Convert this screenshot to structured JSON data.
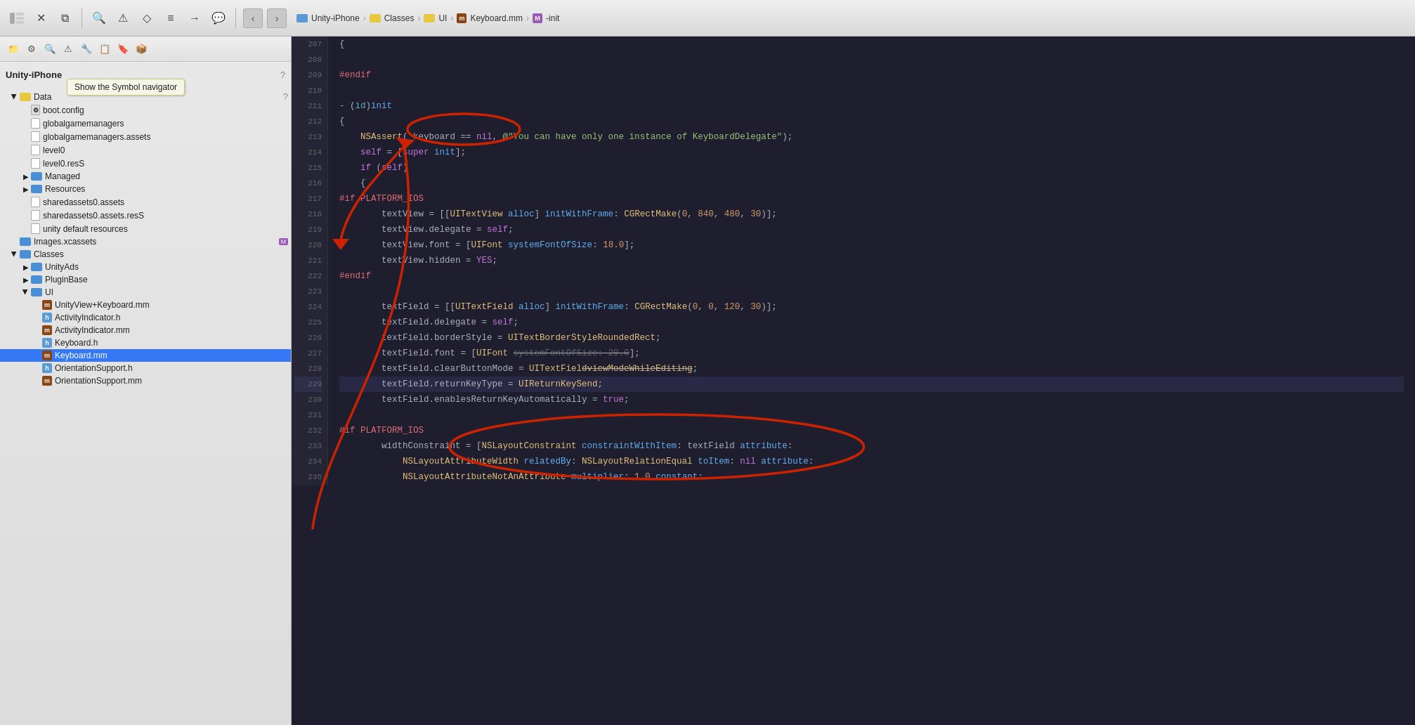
{
  "toolbar": {
    "icons": [
      "⊞",
      "✕",
      "⧉",
      "🔍",
      "⚠",
      "◇",
      "≡",
      "→",
      "💬"
    ],
    "grid_icon": "grid",
    "back_label": "‹",
    "forward_label": "›"
  },
  "breadcrumb": {
    "project": "Unity-iPhone",
    "folder1": "Classes",
    "folder2": "UI",
    "file": "Keyboard.mm",
    "symbol": "-init"
  },
  "sidebar": {
    "title": "Unity-iPhone",
    "items": [
      {
        "id": "unity-iphone",
        "label": "Unity-iPhone",
        "indent": 0,
        "type": "project",
        "expanded": true
      },
      {
        "id": "data",
        "label": "Data",
        "indent": 1,
        "type": "folder",
        "expanded": true
      },
      {
        "id": "boot-config",
        "label": "boot.config",
        "indent": 2,
        "type": "file"
      },
      {
        "id": "globalgamemanagers",
        "label": "globalgamemanagers",
        "indent": 2,
        "type": "file"
      },
      {
        "id": "globalgamemanagers-assets",
        "label": "globalgamemanagers.assets",
        "indent": 2,
        "type": "file"
      },
      {
        "id": "level0",
        "label": "level0",
        "indent": 2,
        "type": "file"
      },
      {
        "id": "level0-ress",
        "label": "level0.resS",
        "indent": 2,
        "type": "file"
      },
      {
        "id": "managed",
        "label": "Managed",
        "indent": 2,
        "type": "folder",
        "collapsed": true
      },
      {
        "id": "resources",
        "label": "Resources",
        "indent": 2,
        "type": "folder",
        "collapsed": true
      },
      {
        "id": "sharedassets0",
        "label": "sharedassets0.assets",
        "indent": 2,
        "type": "file"
      },
      {
        "id": "sharedassets0-ress",
        "label": "sharedassets0.assets.resS",
        "indent": 2,
        "type": "file"
      },
      {
        "id": "unity-default",
        "label": "unity default resources",
        "indent": 2,
        "type": "file"
      },
      {
        "id": "images-xcassets",
        "label": "Images.xcassets",
        "indent": 1,
        "type": "folder",
        "badge": "M"
      },
      {
        "id": "classes",
        "label": "Classes",
        "indent": 1,
        "type": "folder",
        "expanded": true
      },
      {
        "id": "unity-ads",
        "label": "UnityAds",
        "indent": 2,
        "type": "folder",
        "collapsed": true
      },
      {
        "id": "pluginbase",
        "label": "PluginBase",
        "indent": 2,
        "type": "folder",
        "collapsed": true
      },
      {
        "id": "ui",
        "label": "UI",
        "indent": 2,
        "type": "folder",
        "expanded": true
      },
      {
        "id": "unitview-keyboard",
        "label": "UnityView+Keyboard.mm",
        "indent": 3,
        "type": "mm"
      },
      {
        "id": "activity-indicator-h",
        "label": "ActivityIndicator.h",
        "indent": 3,
        "type": "h"
      },
      {
        "id": "activity-indicator-mm",
        "label": "ActivityIndicator.mm",
        "indent": 3,
        "type": "mm"
      },
      {
        "id": "keyboard-h",
        "label": "Keyboard.h",
        "indent": 3,
        "type": "h"
      },
      {
        "id": "keyboard-mm",
        "label": "Keyboard.mm",
        "indent": 3,
        "type": "mm",
        "selected": true
      },
      {
        "id": "orientation-support-h",
        "label": "OrientationSupport.h",
        "indent": 3,
        "type": "h"
      },
      {
        "id": "orientation-support-mm",
        "label": "OrientationSupport.mm",
        "indent": 3,
        "type": "mm"
      }
    ],
    "tooltip": "Show the Symbol navigator"
  },
  "code": {
    "lines": [
      {
        "num": 207,
        "text": "{"
      },
      {
        "num": 208,
        "text": ""
      },
      {
        "num": 209,
        "text": "#endif"
      },
      {
        "num": 210,
        "text": ""
      },
      {
        "num": 211,
        "text": "- (id)init"
      },
      {
        "num": 212,
        "text": "{"
      },
      {
        "num": 213,
        "text": "    NSAssert(_keyboard == nil, @\"You can have only one instance of KeyboardDelegate\");"
      },
      {
        "num": 214,
        "text": "    self = [super init];"
      },
      {
        "num": 215,
        "text": "    if (self)"
      },
      {
        "num": 216,
        "text": "    {"
      },
      {
        "num": 217,
        "text": "#if PLATFORM_IOS"
      },
      {
        "num": 218,
        "text": "        textView = [[UITextView alloc] initWithFrame: CGRectMake(0, 840, 480, 30)];"
      },
      {
        "num": 219,
        "text": "        textView.delegate = self;"
      },
      {
        "num": 220,
        "text": "        textView.font = [UIFont systemFontOfSize: 18.0];"
      },
      {
        "num": 221,
        "text": "        textView.hidden = YES;"
      },
      {
        "num": 222,
        "text": "#endif"
      },
      {
        "num": 223,
        "text": ""
      },
      {
        "num": 224,
        "text": "        textField = [[UITextField alloc] initWithFrame: CGRectMake(0, 0, 120, 30)];"
      },
      {
        "num": 225,
        "text": "        textField.delegate = self;"
      },
      {
        "num": 226,
        "text": "        textField.borderStyle = UITextBorderStyleRoundedRect;"
      },
      {
        "num": 227,
        "text": "        textField.font = [UIFont systemFontOfSize: 20.0];"
      },
      {
        "num": 228,
        "text": "        textField.clearButtonMode = UITextFieldViewModeWhileEditing;"
      },
      {
        "num": 229,
        "text": "        textField.returnKeyType = UIReturnKeySend;",
        "highlighted": true
      },
      {
        "num": 230,
        "text": "        textField.enablesReturnKeyAutomatically = true;"
      },
      {
        "num": 231,
        "text": ""
      },
      {
        "num": 232,
        "text": "#if PLATFORM_IOS"
      },
      {
        "num": 233,
        "text": "        widthConstraint = [NSLayoutConstraint constraintWithItem: textField attribute:"
      },
      {
        "num": 234,
        "text": "            NSLayoutAttributeWidth relatedBy: NSLayoutRelationEqual toItem: nil attribute:"
      },
      {
        "num": 235,
        "text": "            NSLayoutAttributeNotAnAttribute multiplier: 1.0 constant:"
      }
    ]
  }
}
